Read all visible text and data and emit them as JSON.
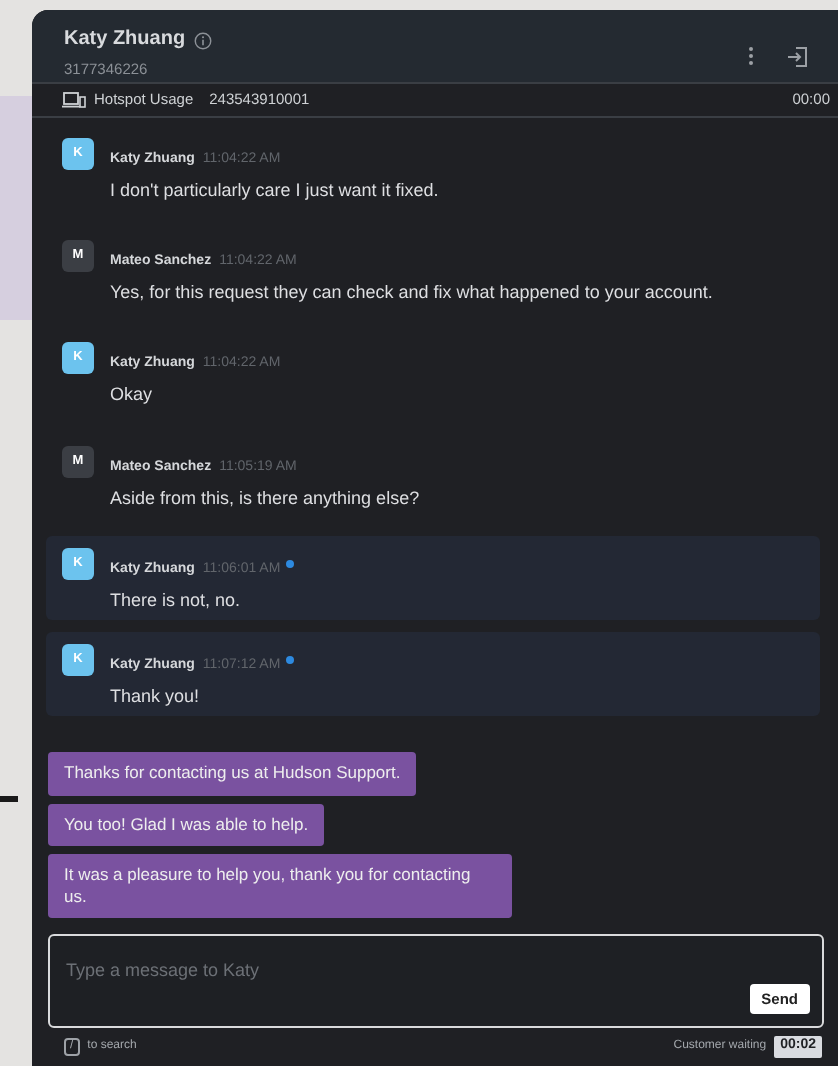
{
  "header": {
    "name": "Katy Zhuang",
    "phone": "3177346226"
  },
  "session": {
    "label": "Hotspot Usage",
    "id": "243543910001",
    "timer": "00:00"
  },
  "messages": [
    {
      "kind": "customer",
      "initial": "K",
      "sender": "Katy Zhuang",
      "time": "11:04:22 AM",
      "text": "I don't particularly care I just want it fixed.",
      "unread": false
    },
    {
      "kind": "agent",
      "initial": "M",
      "sender": "Mateo Sanchez",
      "time": "11:04:22 AM",
      "text": "Yes, for this request they can check and fix what happened to your account.",
      "unread": false
    },
    {
      "kind": "customer",
      "initial": "K",
      "sender": "Katy Zhuang",
      "time": "11:04:22 AM",
      "text": "Okay",
      "unread": false
    },
    {
      "kind": "agent",
      "initial": "M",
      "sender": "Mateo Sanchez",
      "time": "11:05:19 AM",
      "text": "Aside from this, is there anything else?",
      "unread": false
    },
    {
      "kind": "customer",
      "initial": "K",
      "sender": "Katy Zhuang",
      "time": "11:06:01 AM",
      "text": "There is not, no.",
      "unread": true
    },
    {
      "kind": "customer",
      "initial": "K",
      "sender": "Katy Zhuang",
      "time": "11:07:12 AM",
      "text": "Thank you!",
      "unread": true
    }
  ],
  "quick_replies": [
    "Thanks for contacting us at Hudson Support.",
    "You too! Glad I was able to help.",
    "It was a pleasure to help you, thank you for contacting us."
  ],
  "composer": {
    "placeholder": "Type a message to Katy",
    "send": "Send"
  },
  "footer": {
    "key": "/",
    "hint": "to search",
    "waiting_label": "Customer waiting",
    "waiting_time": "00:02"
  }
}
